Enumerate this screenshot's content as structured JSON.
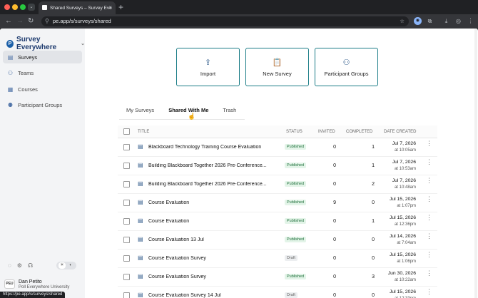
{
  "browser": {
    "tab_title": "Shared Surveys – Survey Eve",
    "url": "pe.app/s/surveys/shared",
    "status_url": "https://pe.app/s/surveys/shared"
  },
  "sidebar": {
    "brand": "Survey Everywhere",
    "items": [
      {
        "label": "Surveys",
        "icon": "surveys-icon"
      },
      {
        "label": "Teams",
        "icon": "teams-icon"
      },
      {
        "label": "Courses",
        "icon": "courses-icon"
      },
      {
        "label": "Participant Groups",
        "icon": "participant-groups-icon"
      }
    ],
    "user": {
      "initials": "PEU",
      "name": "Dan Petito",
      "org": "Poll Everywhere University"
    }
  },
  "actions": {
    "import": "Import",
    "new_survey": "New Survey",
    "participant_groups": "Participant Groups"
  },
  "tabs": [
    "My Surveys",
    "Shared With Me",
    "Trash"
  ],
  "active_tab": "Shared With Me",
  "table": {
    "headers": {
      "title": "TITLE",
      "status": "STATUS",
      "invited": "INVITED",
      "completed": "COMPLETED",
      "date": "DATE CREATED"
    },
    "rows": [
      {
        "title": "Blackboard Technology Training Course Evaluation",
        "status": "Published",
        "invited": "0",
        "completed": "1",
        "date": "Jul 7, 2026",
        "time": "at 10:05am"
      },
      {
        "title": "Building Blackboard Together 2026 Pre-Conference...",
        "status": "Published",
        "invited": "0",
        "completed": "1",
        "date": "Jul 7, 2026",
        "time": "at 10:53am"
      },
      {
        "title": "Building Blackboard Together 2026 Pre-Conference...",
        "status": "Published",
        "invited": "0",
        "completed": "2",
        "date": "Jul 7, 2026",
        "time": "at 10:48am"
      },
      {
        "title": "Course Evaluation",
        "status": "Published",
        "invited": "9",
        "completed": "0",
        "date": "Jul 15, 2026",
        "time": "at 1:07pm"
      },
      {
        "title": "Course Evaluation",
        "status": "Published",
        "invited": "0",
        "completed": "1",
        "date": "Jul 15, 2026",
        "time": "at 12:36pm"
      },
      {
        "title": "Course Evaluation 13 Jul",
        "status": "Published",
        "invited": "0",
        "completed": "0",
        "date": "Jul 14, 2026",
        "time": "at 7:04am"
      },
      {
        "title": "Course Evaluation Survey",
        "status": "Draft",
        "invited": "0",
        "completed": "0",
        "date": "Jul 15, 2026",
        "time": "at 1:06pm"
      },
      {
        "title": "Course Evaluation Survey",
        "status": "Published",
        "invited": "0",
        "completed": "3",
        "date": "Jun 30, 2026",
        "time": "at 10:22am"
      },
      {
        "title": "Course Evaluation Survey 14 Jul",
        "status": "Draft",
        "invited": "0",
        "completed": "0",
        "date": "Jul 15, 2026",
        "time": "at 12:33pm"
      }
    ]
  }
}
